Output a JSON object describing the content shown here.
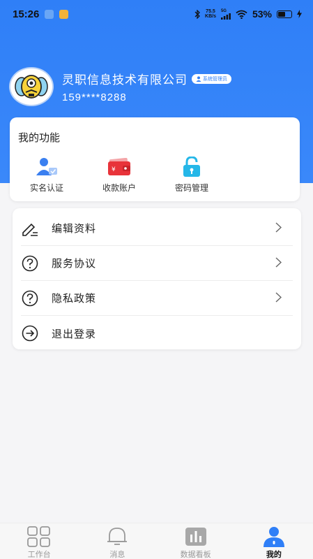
{
  "status_bar": {
    "time": "15:26",
    "net_speed_value": "75.5",
    "net_speed_unit": "KB/s",
    "signal_type": "5G",
    "battery_percent": "53%",
    "battery_level": 0.53
  },
  "profile": {
    "company_name": "灵职信息技术有限公司",
    "role_badge": "系统管理员",
    "phone": "159****8288"
  },
  "features": {
    "title": "我的功能",
    "items": [
      {
        "label": "实名认证",
        "icon": "user-verify-icon"
      },
      {
        "label": "收款账户",
        "icon": "wallet-icon"
      },
      {
        "label": "密码管理",
        "icon": "lock-icon"
      }
    ]
  },
  "menu": {
    "items": [
      {
        "label": "编辑资料",
        "icon": "edit-icon"
      },
      {
        "label": "服务协议",
        "icon": "question-icon"
      },
      {
        "label": "隐私政策",
        "icon": "question-icon"
      },
      {
        "label": "退出登录",
        "icon": "logout-icon"
      }
    ]
  },
  "tabbar": {
    "items": [
      {
        "label": "工作台",
        "icon": "grid-icon",
        "active": false
      },
      {
        "label": "消息",
        "icon": "bell-icon",
        "active": false
      },
      {
        "label": "数据看板",
        "icon": "chart-icon",
        "active": false
      },
      {
        "label": "我的",
        "icon": "user-icon",
        "active": true
      }
    ]
  },
  "colors": {
    "brand_blue": "#2f7ff7",
    "wallet_red": "#e8333a",
    "lock_cyan": "#25b7e8"
  }
}
